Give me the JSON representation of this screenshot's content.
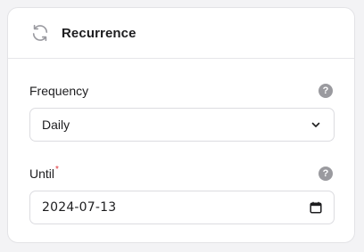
{
  "card": {
    "title": "Recurrence",
    "header_icon": "refresh-icon"
  },
  "frequency": {
    "label": "Frequency",
    "selected_value": "Daily",
    "help_icon": "help-icon",
    "dropdown_icon": "chevron-down-icon"
  },
  "until": {
    "label": "Until",
    "required_mark": "*",
    "value": "2024-07-13",
    "help_icon": "help-icon",
    "calendar_icon": "calendar-icon"
  },
  "colors": {
    "required": "#e0343a",
    "help_icon_bg": "#9a9a9f",
    "border": "#dcdce0",
    "text": "#1d1d1f"
  }
}
